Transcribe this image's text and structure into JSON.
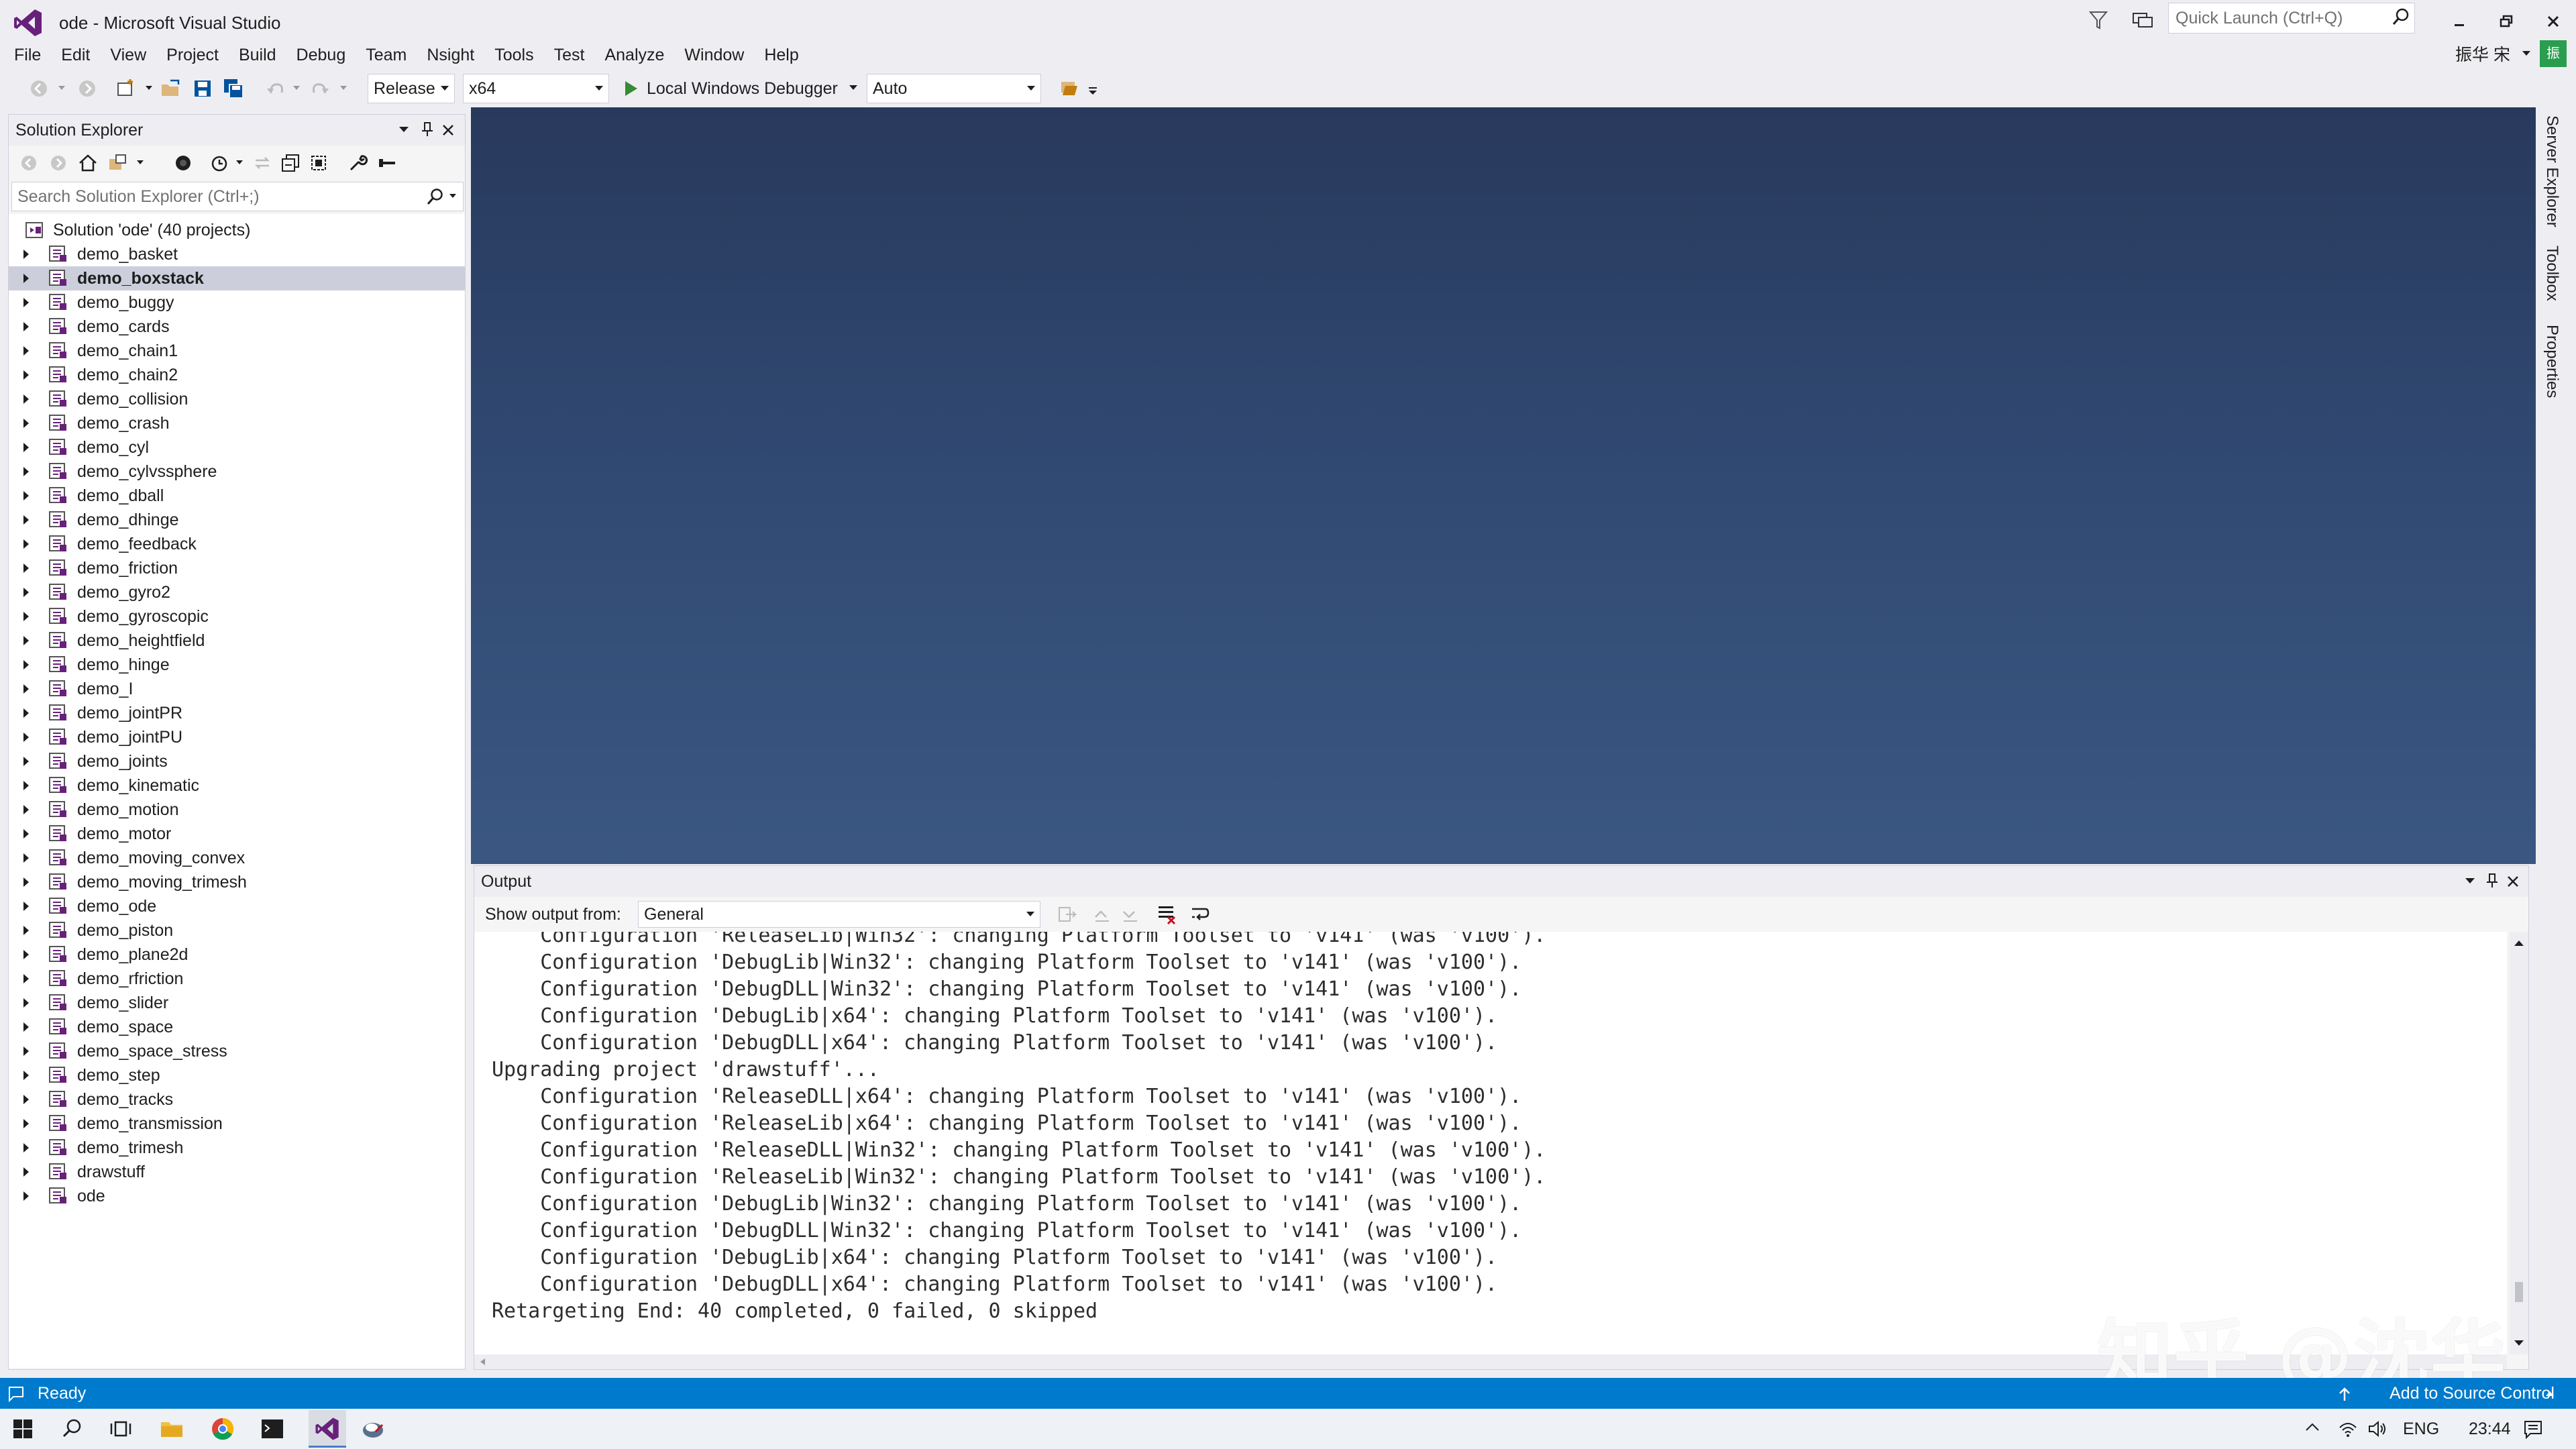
{
  "window": {
    "title": "ode - Microsoft Visual Studio",
    "quick_launch_placeholder": "Quick Launch (Ctrl+Q)",
    "user_name": "振华 宋",
    "user_initial": "振"
  },
  "menu": [
    "File",
    "Edit",
    "View",
    "Project",
    "Build",
    "Debug",
    "Team",
    "Nsight",
    "Tools",
    "Test",
    "Analyze",
    "Window",
    "Help"
  ],
  "toolbar": {
    "configuration": "Release",
    "platform": "x64",
    "debugger_label": "Local Windows Debugger",
    "solution_config": "Auto"
  },
  "solution_explorer": {
    "title": "Solution Explorer",
    "search_placeholder": "Search Solution Explorer (Ctrl+;)",
    "root_label": "Solution 'ode' (40 projects)",
    "selected_index": 1,
    "projects": [
      "demo_basket",
      "demo_boxstack",
      "demo_buggy",
      "demo_cards",
      "demo_chain1",
      "demo_chain2",
      "demo_collision",
      "demo_crash",
      "demo_cyl",
      "demo_cylvssphere",
      "demo_dball",
      "demo_dhinge",
      "demo_feedback",
      "demo_friction",
      "demo_gyro2",
      "demo_gyroscopic",
      "demo_heightfield",
      "demo_hinge",
      "demo_I",
      "demo_jointPR",
      "demo_jointPU",
      "demo_joints",
      "demo_kinematic",
      "demo_motion",
      "demo_motor",
      "demo_moving_convex",
      "demo_moving_trimesh",
      "demo_ode",
      "demo_piston",
      "demo_plane2d",
      "demo_rfriction",
      "demo_slider",
      "demo_space",
      "demo_space_stress",
      "demo_step",
      "demo_tracks",
      "demo_transmission",
      "demo_trimesh",
      "drawstuff",
      "ode"
    ]
  },
  "side_tabs": [
    "Server Explorer",
    "Toolbox",
    "Properties"
  ],
  "output": {
    "title": "Output",
    "show_from_label": "Show output from:",
    "source": "General",
    "lines": [
      "    Configuration 'DebugLib|Win32': changing Platform Toolset to 'v141' (was 'v100').",
      "    Configuration 'DebugDLL|Win32': changing Platform Toolset to 'v141' (was 'v100').",
      "    Configuration 'DebugLib|x64': changing Platform Toolset to 'v141' (was 'v100').",
      "    Configuration 'DebugDLL|x64': changing Platform Toolset to 'v141' (was 'v100').",
      "Upgrading project 'drawstuff'...",
      "    Configuration 'ReleaseDLL|x64': changing Platform Toolset to 'v141' (was 'v100').",
      "    Configuration 'ReleaseLib|x64': changing Platform Toolset to 'v141' (was 'v100').",
      "    Configuration 'ReleaseDLL|Win32': changing Platform Toolset to 'v141' (was 'v100').",
      "    Configuration 'ReleaseLib|Win32': changing Platform Toolset to 'v141' (was 'v100').",
      "    Configuration 'DebugLib|Win32': changing Platform Toolset to 'v141' (was 'v100').",
      "    Configuration 'DebugDLL|Win32': changing Platform Toolset to 'v141' (was 'v100').",
      "    Configuration 'DebugLib|x64': changing Platform Toolset to 'v141' (was 'v100').",
      "    Configuration 'DebugDLL|x64': changing Platform Toolset to 'v141' (was 'v100').",
      "Retargeting End: 40 completed, 0 failed, 0 skipped"
    ]
  },
  "watermark": "知乎 @沈华",
  "status": {
    "text": "Ready",
    "source_control": "Add to Source Control"
  },
  "taskbar": {
    "lang": "ENG",
    "time": "23:44"
  },
  "colors": {
    "status_bar": "#007acc",
    "vs_purple": "#68217a",
    "editor_bg": "#2f4670"
  }
}
